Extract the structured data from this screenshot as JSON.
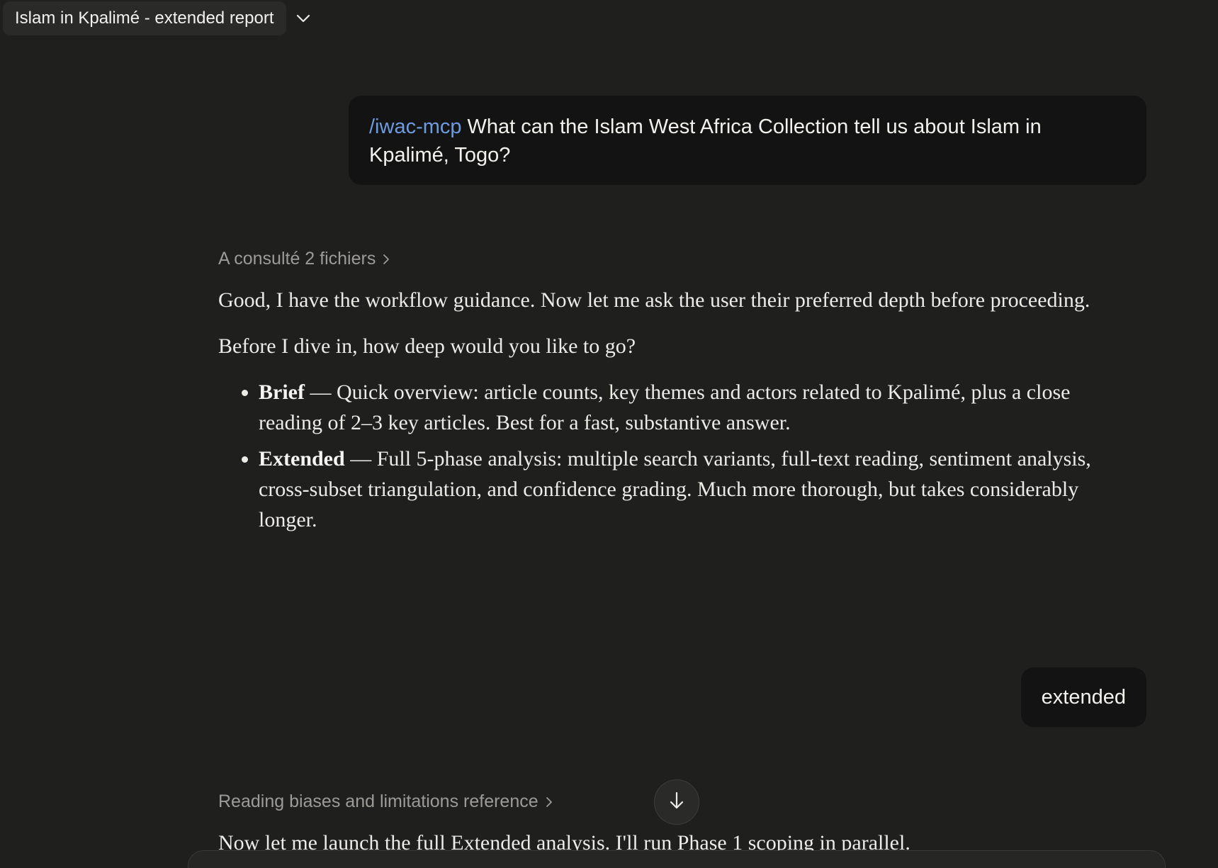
{
  "header": {
    "conversation_title": "Islam in Kpalimé - extended report",
    "chevron_icon": "chevron-down-icon"
  },
  "messages": {
    "user_1": {
      "command": "/iwac-mcp",
      "text": "What can the Islam West Africa Collection tell us about Islam in Kpalimé, Togo?"
    },
    "tool_1": {
      "label": "A consulté 2 fichiers",
      "icon": "chevron-right-icon"
    },
    "assistant_1": {
      "para_1": "Good, I have the workflow guidance. Now let me ask the user their preferred depth before proceeding.",
      "para_2": "Before I dive in, how deep would you like to go?",
      "options": [
        {
          "title": "Brief",
          "description": "— Quick overview: article counts, key themes and actors related to Kpalimé, plus a close reading of 2–3 key articles. Best for a fast, substantive answer."
        },
        {
          "title": "Extended",
          "description": "— Full 5-phase analysis: multiple search variants, full-text reading, sentiment analysis, cross-subset triangulation, and confidence grading. Much more thorough, but takes considerably longer."
        }
      ]
    },
    "user_2": {
      "text": "extended"
    },
    "tool_2": {
      "label": "Reading biases and limitations reference",
      "icon": "chevron-right-icon"
    },
    "assistant_2": {
      "para_1": "Now let me launch the full Extended analysis. I'll run Phase 1 scoping in parallel."
    }
  },
  "controls": {
    "scroll_down_icon": "arrow-down-icon"
  },
  "colors": {
    "background": "#1f1f1e",
    "user_bubble": "#131313",
    "command_accent": "#6d9be0",
    "muted_text": "#9c9b96"
  }
}
